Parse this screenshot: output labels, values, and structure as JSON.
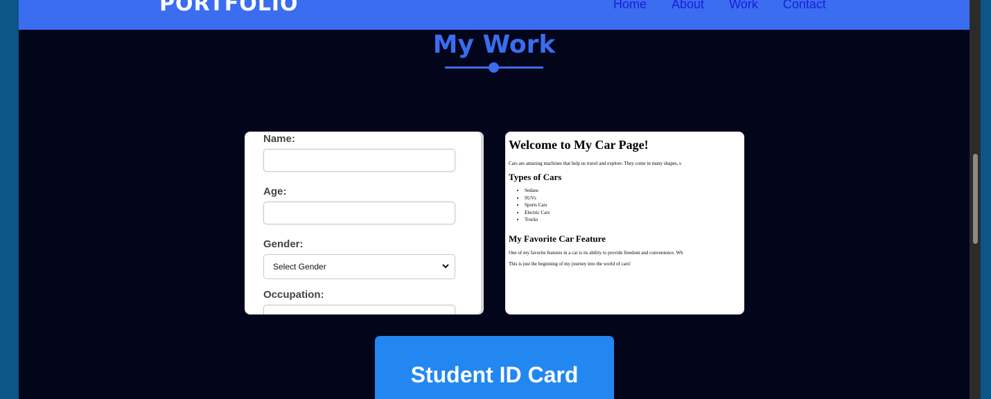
{
  "nav": {
    "brand": "PORTFOLIO",
    "links": [
      "Home",
      "About",
      "Work",
      "Contact"
    ]
  },
  "section": {
    "title": "My Work"
  },
  "form_preview": {
    "name_label": "Name:",
    "age_label": "Age:",
    "gender_label": "Gender:",
    "gender_selected": "Select Gender",
    "occupation_label": "Occupation:"
  },
  "car_preview": {
    "heading": "Welcome to My Car Page!",
    "intro": "Cars are amazing machines that help us travel and explore. They come in many shapes, s",
    "types_heading": "Types of Cars",
    "types": [
      "Sedans",
      "SUVs",
      "Sports Cars",
      "Electric Cars",
      "Trucks"
    ],
    "feature_heading": "My Favorite Car Feature",
    "feature_text": "One of my favorite features in a car is its ability to provide freedom and convenience. Wh",
    "closing": "This is just the beginning of my journey into the world of cars!"
  },
  "cta": {
    "label": "Student ID Card"
  },
  "colors": {
    "accent": "#3a6df0",
    "background": "#03051a",
    "button": "#2287f0",
    "outer": "#0b5587"
  }
}
